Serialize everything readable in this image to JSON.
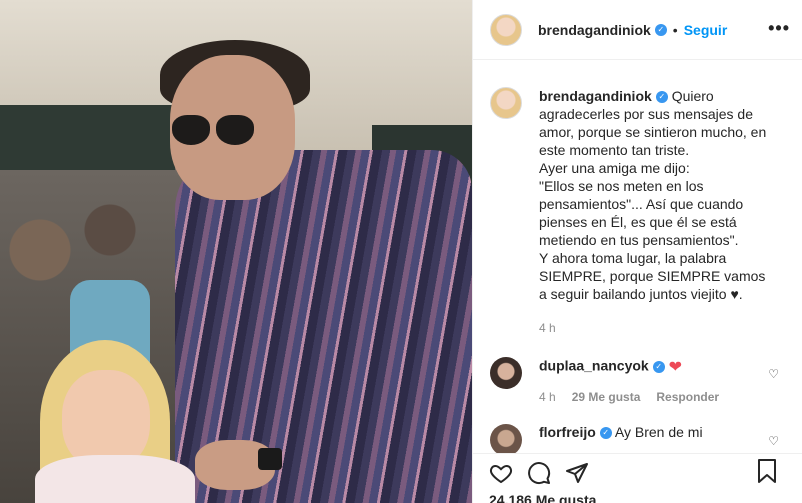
{
  "post": {
    "username": "brendagandiniok",
    "follow_label": "Seguir",
    "separator": "•",
    "more_label": "•••",
    "verified_mark": "✓"
  },
  "caption": {
    "username": "brendagandiniok",
    "lines": [
      "Quiero agradecerles por sus mensajes de amor, porque se sintieron mucho, en este momento tan triste.",
      "Ayer una amiga me dijo:",
      "\"Ellos se nos meten en los pensamientos\"... Así que cuando pienses en Él, es que él se está metiendo en tus pensamientos\".",
      "Y ahora toma lugar, la palabra SIEMPRE, porque SIEMPRE vamos a seguir bailando juntos viejito ♥."
    ],
    "time": "4 h"
  },
  "comments": [
    {
      "username": "duplaa_nancyok",
      "text": "",
      "emoji": "❤",
      "time": "4 h",
      "likes": "29 Me gusta",
      "reply": "Responder"
    },
    {
      "username": "florfreijo",
      "text": "Ay Bren de mi",
      "emoji": "",
      "time": "",
      "likes": "",
      "reply": ""
    }
  ],
  "actions": {
    "likes": "24.186 Me gusta"
  },
  "colors": {
    "accent": "#0095f6",
    "heart": "#ed4956",
    "muted": "#8e8e8e",
    "text": "#262626"
  },
  "icons": [
    "heart-icon",
    "comment-icon",
    "share-icon",
    "bookmark-icon",
    "more-icon",
    "verified-icon"
  ]
}
